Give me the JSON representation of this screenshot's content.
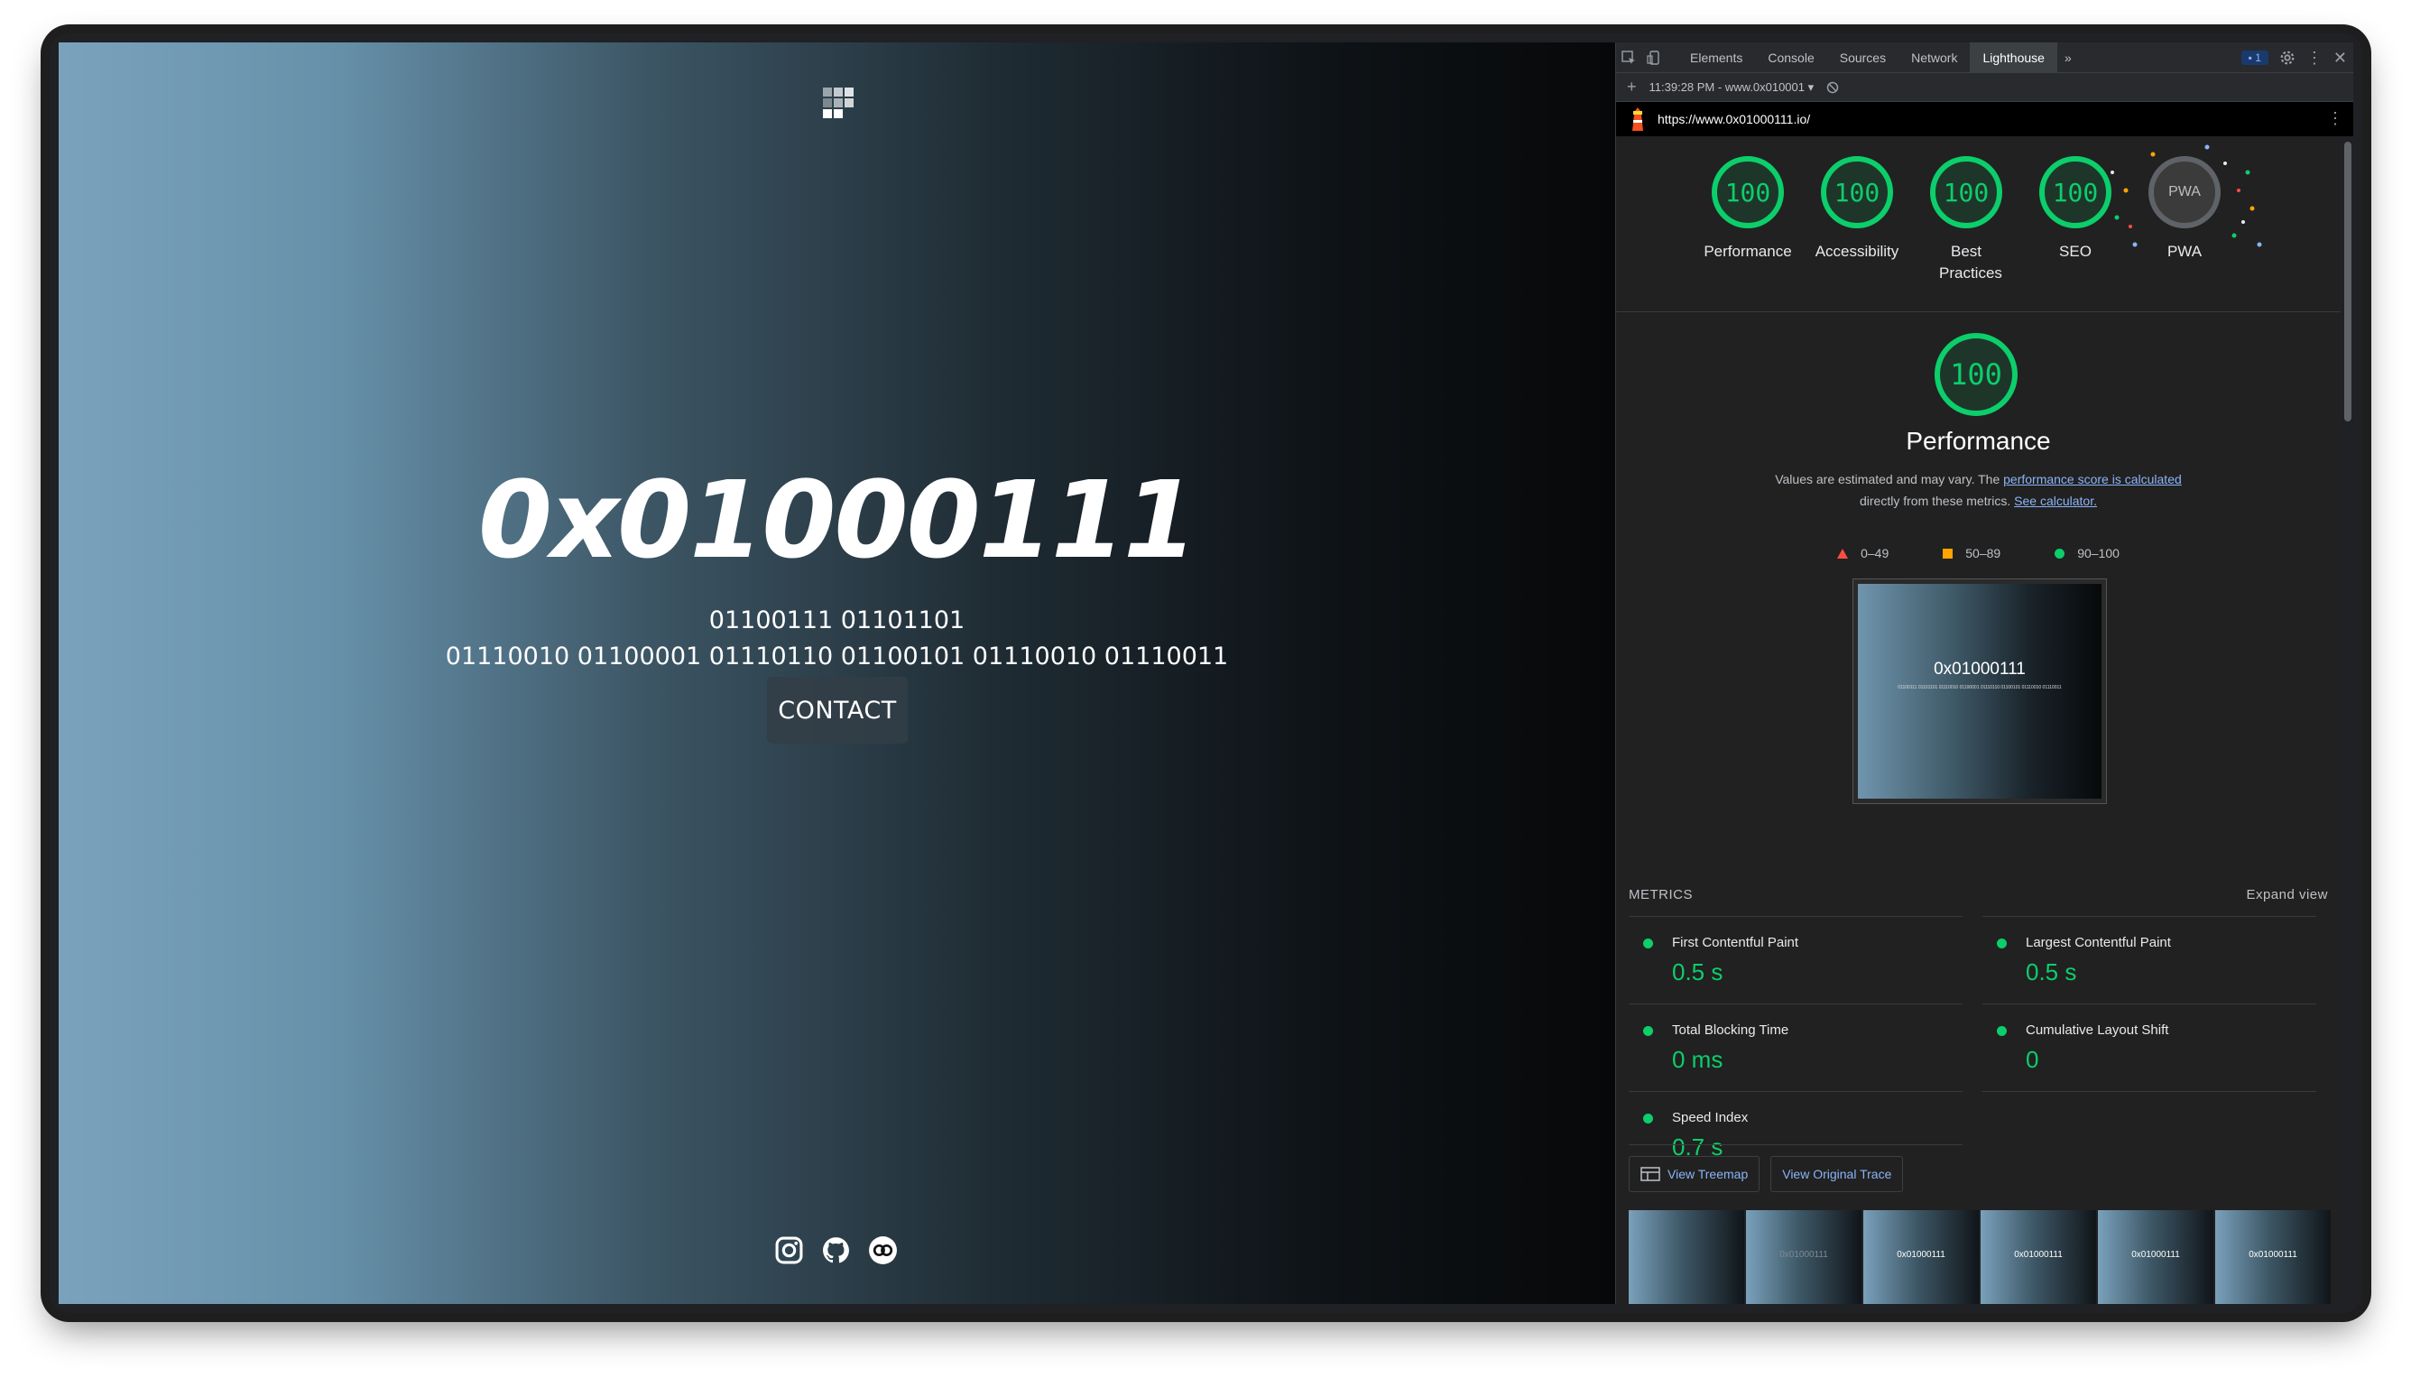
{
  "site": {
    "hero_title": "0x01000111",
    "binary_line_1": "01100111 01101101",
    "binary_line_2": "01110010 01100001 01110110 01100101 01110010 01110011",
    "contact_label": "CONTACT",
    "socials": [
      "instagram-icon",
      "github-icon",
      "chain-icon"
    ]
  },
  "devtools": {
    "tabs": [
      "Elements",
      "Console",
      "Sources",
      "Network",
      "Lighthouse"
    ],
    "active_tab": "Lighthouse",
    "overflow": "»",
    "issues_count": "1",
    "report_time": "11:39:28 PM - www.0x010001 ▾",
    "url": "https://www.0x01000111.io/"
  },
  "lighthouse": {
    "gauges": [
      {
        "score": "100",
        "label": "Performance"
      },
      {
        "score": "100",
        "label": "Accessibility"
      },
      {
        "score": "100",
        "label": "Best Practices"
      },
      {
        "score": "100",
        "label": "SEO"
      },
      {
        "score": "PWA",
        "label": "PWA"
      }
    ],
    "perf_score": "100",
    "perf_title": "Performance",
    "desc_prefix": "Values are estimated and may vary. The ",
    "desc_link1": "performance score is calculated",
    "desc_middle": "directly from these metrics. ",
    "desc_link2": "See calculator.",
    "legend": [
      "0–49",
      "50–89",
      "90–100"
    ],
    "screenshot_title": "0x01000111",
    "screenshot_sub": "01100111 01101101 01110010 01100001 01110110 01100101 01110010 01110011",
    "metrics_label": "METRICS",
    "expand_label": "Expand view",
    "metrics": [
      {
        "name": "First Contentful Paint",
        "value": "0.5 s"
      },
      {
        "name": "Largest Contentful Paint",
        "value": "0.5 s"
      },
      {
        "name": "Total Blocking Time",
        "value": "0 ms"
      },
      {
        "name": "Cumulative Layout Shift",
        "value": "0"
      },
      {
        "name": "Speed Index",
        "value": "0.7 s"
      }
    ],
    "treemap_label": "View Treemap",
    "trace_label": "View Original Trace",
    "filmstrip_text": "0x01000111"
  },
  "colors": {
    "pass": "#0cce6b",
    "average": "#ffa400",
    "fail": "#ff4e42",
    "link": "#8ab4f8"
  }
}
